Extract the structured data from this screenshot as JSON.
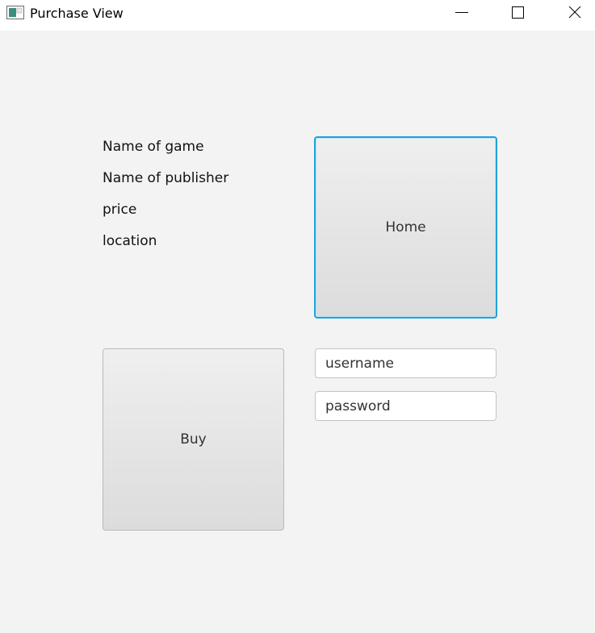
{
  "window": {
    "title": "Purchase View",
    "controls": {
      "minimize_icon": "minimize-icon",
      "maximize_icon": "maximize-icon",
      "close_icon": "close-icon"
    }
  },
  "info": {
    "game_name": "Name of game",
    "publisher_name": "Name of publisher",
    "price": "price",
    "location": "location"
  },
  "buttons": {
    "home_label": "Home",
    "buy_label": "Buy"
  },
  "login": {
    "username_placeholder": "username",
    "username_value": "",
    "password_placeholder": "password",
    "password_value": ""
  },
  "colors": {
    "background": "#f3f3f3",
    "focus_ring": "#1ea3dc",
    "button_top": "#efefef",
    "button_bottom": "#dcdcdc"
  }
}
